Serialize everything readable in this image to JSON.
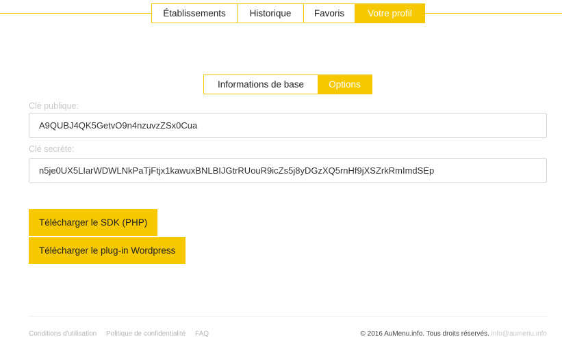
{
  "nav": {
    "tabs": [
      {
        "label": "Établissements"
      },
      {
        "label": "Historique"
      },
      {
        "label": "Favoris"
      },
      {
        "label": "Votre profil",
        "active": true
      }
    ]
  },
  "subnav": {
    "tabs": [
      {
        "label": "Informations de base"
      },
      {
        "label": "Options",
        "active": true
      }
    ]
  },
  "fields": {
    "public_key": {
      "label": "Clé publique:",
      "value": "A9QUBJ4QK5GetvO9n4nzuvzZSx0Cua"
    },
    "secret_key": {
      "label": "Clé secrète:",
      "value": "n5je0UX5LIarWDWLNkPaTjFtjx1kawuxBNLBIJGtrRUouR9icZs5j8yDGzXQ5rnHf9jXSZrkRmImdSEp"
    }
  },
  "buttons": {
    "sdk_php": "Télécharger le SDK (PHP)",
    "wordpress_plugin": "Télécharger le plug-in Wordpress"
  },
  "footer": {
    "links": [
      "Conditions d'utilisation",
      "Politique de confidentialité",
      "FAQ"
    ],
    "copyright": "© 2016 AuMenu.info. Tous droits réservés.",
    "email": "info@aumenu.info"
  },
  "colors": {
    "accent": "#f5c800"
  }
}
